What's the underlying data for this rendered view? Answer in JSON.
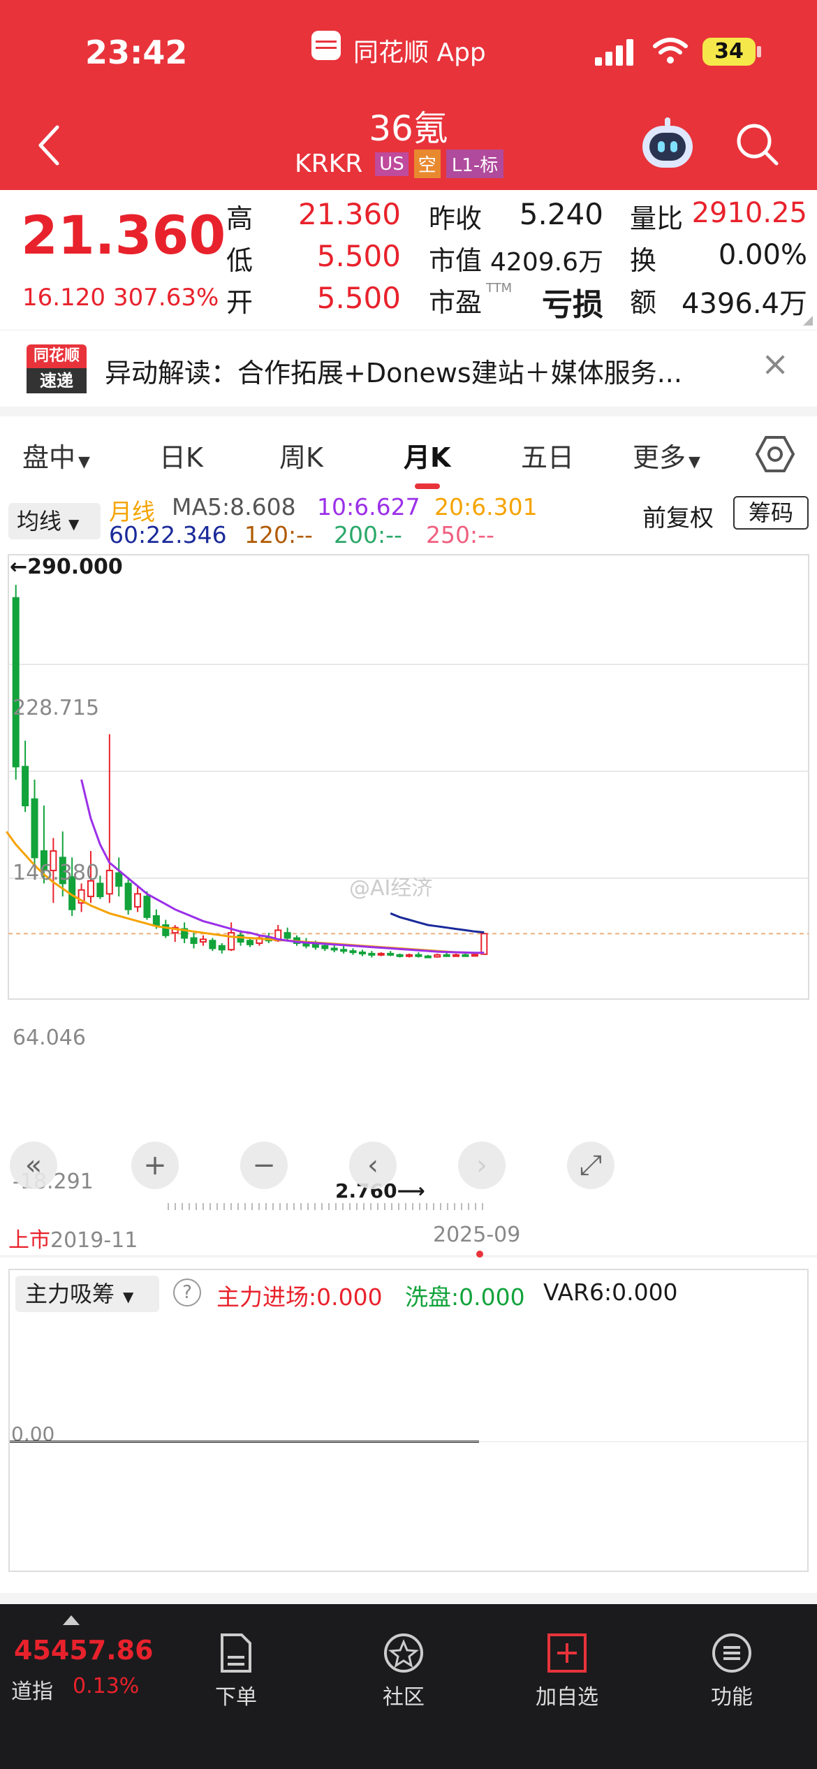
{
  "status_bar": {
    "time": "23:42",
    "app_name": "同花顺 App",
    "battery": "34"
  },
  "nav": {
    "title": "36氪",
    "ticker": "KRKR",
    "badges": [
      "US",
      "空",
      "L1-标"
    ]
  },
  "quote": {
    "price": "21.360",
    "change": "16.120",
    "change_pct": "307.63%",
    "rows": [
      [
        {
          "label": "高",
          "value": "21.360"
        },
        {
          "label": "昨收",
          "value": "5.240"
        },
        {
          "label": "量比",
          "value": "2910.25"
        }
      ],
      [
        {
          "label": "低",
          "value": "5.500"
        },
        {
          "label": "市值",
          "value": "4209.6万"
        },
        {
          "label": "换",
          "value": "0.00%"
        }
      ],
      [
        {
          "label": "开",
          "value": "5.500"
        },
        {
          "label": "市盈",
          "sup": "TTM",
          "value": "亏损"
        },
        {
          "label": "额",
          "value": "4396.4万"
        }
      ]
    ]
  },
  "news": {
    "logo_top": "同花顺",
    "logo_bottom": "速递",
    "text": "异动解读：合作拓展+Donews建站＋媒体服务...",
    "close": "×"
  },
  "tabs": [
    {
      "label": "盘中",
      "dropdown": true
    },
    {
      "label": "日K"
    },
    {
      "label": "周K"
    },
    {
      "label": "月K",
      "active": true
    },
    {
      "label": "五日"
    },
    {
      "label": "更多",
      "dropdown": true
    }
  ],
  "indicator": {
    "selector": "均线",
    "ma_labels": [
      {
        "text": "月线",
        "color": "#f5a300"
      },
      {
        "text": "MA5:8.608",
        "color": "#555555"
      },
      {
        "text": "10:6.627",
        "color": "#9b30e8"
      },
      {
        "text": "20:6.301",
        "color": "#f5a300"
      },
      {
        "text": "60:22.346",
        "color": "#1a2a9a"
      },
      {
        "text": "120:--",
        "color": "#b05a00"
      },
      {
        "text": "200:--",
        "color": "#2aa86a"
      },
      {
        "text": "250:--",
        "color": "#f06080"
      }
    ],
    "adjust": "前复权",
    "chip_button": "筹码"
  },
  "chart_data": {
    "type": "candlestick",
    "y_axis_labels": [
      "228.715",
      "146.380",
      "64.046",
      "-18.291"
    ],
    "max_label": "290.000",
    "min_label": "2.760",
    "x_start_tag": "上市",
    "x_start": "2019-11",
    "x_end": "2025-09",
    "watermark": "@AI经济",
    "ylim": [
      -18.291,
      311.05
    ],
    "candles": [
      [
        280,
        290,
        150,
        140
      ],
      [
        150,
        170,
        120,
        115
      ],
      [
        125,
        140,
        80,
        75
      ],
      [
        85,
        120,
        70,
        60
      ],
      [
        70,
        95,
        85,
        45
      ],
      [
        80,
        100,
        60,
        50
      ],
      [
        65,
        80,
        40,
        35
      ],
      [
        45,
        60,
        55,
        38
      ],
      [
        50,
        85,
        62,
        45
      ],
      [
        60,
        66,
        50,
        48
      ],
      [
        52,
        175,
        70,
        45
      ],
      [
        68,
        80,
        58,
        50
      ],
      [
        60,
        65,
        40,
        36
      ],
      [
        42,
        58,
        52,
        38
      ],
      [
        50,
        54,
        34,
        32
      ],
      [
        35,
        40,
        28,
        25
      ],
      [
        28,
        32,
        20,
        18
      ],
      [
        22,
        28,
        26,
        15
      ],
      [
        25,
        30,
        18,
        14
      ],
      [
        18,
        22,
        14,
        10
      ],
      [
        15,
        20,
        17,
        12
      ],
      [
        16,
        18,
        10,
        8
      ],
      [
        12,
        14,
        9,
        6
      ],
      [
        9,
        30,
        22,
        8
      ],
      [
        20,
        24,
        15,
        12
      ],
      [
        16,
        18,
        13,
        11
      ],
      [
        14,
        20,
        18,
        12
      ],
      [
        18,
        22,
        16,
        14
      ],
      [
        16,
        28,
        24,
        15
      ],
      [
        22,
        26,
        18,
        16
      ],
      [
        18,
        20,
        14,
        12
      ],
      [
        15,
        18,
        12,
        10
      ],
      [
        13,
        16,
        11,
        9
      ],
      [
        12,
        14,
        10,
        8
      ],
      [
        10,
        13,
        9,
        7
      ],
      [
        9,
        12,
        8,
        6
      ],
      [
        8,
        10,
        7,
        5
      ],
      [
        7,
        9,
        6,
        4
      ],
      [
        6,
        8,
        5,
        3
      ],
      [
        5,
        7,
        6,
        4
      ],
      [
        6,
        8,
        5,
        4
      ],
      [
        5,
        6,
        4,
        3
      ],
      [
        4,
        6,
        5,
        3
      ],
      [
        5,
        7,
        4,
        3
      ],
      [
        4,
        5,
        3,
        2.8
      ],
      [
        3.5,
        6,
        5,
        2.76
      ],
      [
        5,
        7,
        4,
        3.5
      ],
      [
        4.5,
        6,
        5,
        4
      ],
      [
        5,
        6,
        4.5,
        4
      ],
      [
        4.6,
        6,
        5.2,
        4
      ],
      [
        5.5,
        21.36,
        21.36,
        5.5
      ]
    ],
    "ma10": [
      140,
      110,
      90,
      76,
      70,
      64,
      58,
      52,
      48,
      44,
      40,
      37,
      34,
      31,
      29,
      27,
      25,
      23,
      22,
      20,
      19,
      17,
      16,
      15,
      14.5,
      14,
      13.5,
      13,
      12.5,
      12,
      11.5,
      11,
      10.5,
      10,
      9.5,
      9,
      8.5,
      8,
      7.5,
      7.2,
      7,
      6.8,
      6.6,
      6.627
    ],
    "ma20": [
      100,
      90,
      82,
      74,
      67,
      61,
      56,
      51,
      47,
      43,
      40,
      37,
      35,
      33,
      31,
      29,
      27,
      26,
      25,
      24,
      23,
      22,
      21,
      20,
      19,
      18.5,
      18,
      17.5,
      17,
      16.5,
      16,
      15.5,
      15,
      14.5,
      14,
      13.5,
      13,
      12.5,
      12,
      11.5,
      11,
      10.5,
      10,
      9.5,
      9,
      8.5,
      8,
      7.5,
      7,
      6.8,
      6.5,
      6.301
    ],
    "ma60": [
      37,
      34,
      32,
      30,
      28,
      27,
      26,
      25,
      24,
      23,
      22.346
    ]
  },
  "chart_controls": [
    "«",
    "+",
    "−",
    "‹",
    "›",
    "⤢"
  ],
  "sub_indicator": {
    "selector": "主力吸筹",
    "help": "?",
    "labels": [
      {
        "text": "主力进场:0.000",
        "color": "#e8222c"
      },
      {
        "text": "洗盘:0.000",
        "color": "#12a33b"
      },
      {
        "text": "VAR6:0.000",
        "color": "#1a1a1a"
      }
    ],
    "zero_label": "0.00"
  },
  "tabbar": {
    "index_value": "45457.86",
    "index_name": "道指",
    "index_change": "0.13%",
    "items": [
      "下单",
      "社区",
      "加自选",
      "功能"
    ]
  }
}
